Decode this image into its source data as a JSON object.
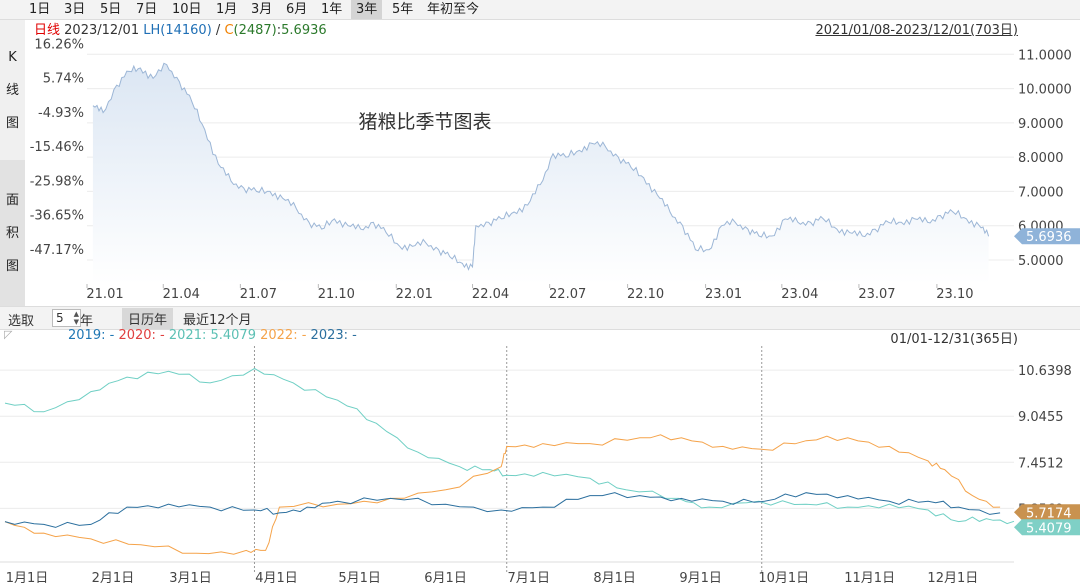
{
  "period_tabs": [
    {
      "label": "1日",
      "active": false
    },
    {
      "label": "3日",
      "active": false
    },
    {
      "label": "5日",
      "active": false
    },
    {
      "label": "7日",
      "active": false
    },
    {
      "label": "10日",
      "active": false
    },
    {
      "label": "1月",
      "active": false
    },
    {
      "label": "3月",
      "active": false
    },
    {
      "label": "6月",
      "active": false
    },
    {
      "label": "1年",
      "active": false
    },
    {
      "label": "3年",
      "active": true
    },
    {
      "label": "5年",
      "active": false
    },
    {
      "label": "年初至今",
      "active": false
    }
  ],
  "side_tabs": {
    "kline": [
      "K",
      "线",
      "图"
    ],
    "area": [
      "面",
      "积",
      "图"
    ]
  },
  "top_info": {
    "kind": "日线",
    "date": "2023/12/01",
    "lh_label": "LH",
    "lh_value": "(14160)",
    "slash": "/",
    "c_label": "C",
    "c_value": "(2487)",
    "colon": ":",
    "value": "5.6936",
    "range": "2021/01/08-2023/12/01(703日)"
  },
  "colors": {
    "kind": "#e00000",
    "lh": "#1f6fb5",
    "c": "#f08000",
    "value": "#2c7a2c",
    "line": "#9cb6d6",
    "badge": "#8fb3d9",
    "s2019": "#1f77b4",
    "s2020": "#e04040",
    "s2021": "#6fcfc4",
    "s2022": "#f5a34a",
    "s2023": "#2b6f9e"
  },
  "controls": {
    "select_label": "选取",
    "years": "5",
    "year_unit": "年",
    "calendar_button": "日历年",
    "recent_button": "最近12个月"
  },
  "legend": [
    {
      "label": "2019: -",
      "key": "s2019"
    },
    {
      "label": "2020: -",
      "key": "s2020"
    },
    {
      "label": "2021: 5.4079",
      "key": "s2021"
    },
    {
      "label": "2022: -",
      "key": "s2022"
    },
    {
      "label": "2023: -",
      "key": "s2023"
    }
  ],
  "bottom_range": "01/01-12/31(365日)",
  "chart_data": [
    {
      "type": "area",
      "title": "猪粮比季节图表",
      "x_ticks": [
        "21.01",
        "21.04",
        "21.07",
        "21.10",
        "22.01",
        "22.04",
        "22.07",
        "22.10",
        "23.01",
        "23.04",
        "23.07",
        "23.10"
      ],
      "y_right_ticks": [
        "11.0000",
        "10.0000",
        "9.0000",
        "8.0000",
        "7.0000",
        "6.0000",
        "5.0000"
      ],
      "y_left_ticks": [
        "16.26%",
        "5.74%",
        "-4.93%",
        "-15.46%",
        "-25.98%",
        "-36.65%",
        "-47.17%"
      ],
      "ylim": [
        4.3,
        11.3
      ],
      "last_value": "5.6936",
      "series": [
        {
          "x": [
            "2021-01-08",
            "2021-01-20",
            "2021-02-05",
            "2021-02-20",
            "2021-03-05",
            "2021-03-20",
            "2021-04-05",
            "2021-04-20",
            "2021-05-05",
            "2021-05-20",
            "2021-06-05",
            "2021-06-20",
            "2021-07-05",
            "2021-07-20",
            "2021-08-05",
            "2021-08-20",
            "2021-09-05",
            "2021-09-20",
            "2021-10-05",
            "2021-10-20",
            "2021-11-05",
            "2021-11-20",
            "2021-12-05",
            "2021-12-20",
            "2022-01-05",
            "2022-01-20",
            "2022-02-05",
            "2022-02-20",
            "2022-03-05",
            "2022-03-20",
            "2022-04-01",
            "2022-04-05",
            "2022-04-20",
            "2022-05-05",
            "2022-05-20",
            "2022-06-05",
            "2022-06-20",
            "2022-07-05",
            "2022-07-20",
            "2022-08-05",
            "2022-08-20",
            "2022-09-05",
            "2022-09-20",
            "2022-10-05",
            "2022-10-20",
            "2022-11-05",
            "2022-11-20",
            "2022-12-05",
            "2022-12-20",
            "2023-01-05",
            "2023-01-20",
            "2023-02-05",
            "2023-02-20",
            "2023-03-05",
            "2023-03-20",
            "2023-04-05",
            "2023-04-20",
            "2023-05-05",
            "2023-05-20",
            "2023-06-05",
            "2023-06-20",
            "2023-07-05",
            "2023-07-20",
            "2023-08-05",
            "2023-08-20",
            "2023-09-05",
            "2023-09-20",
            "2023-10-05",
            "2023-10-20",
            "2023-11-05",
            "2023-11-20",
            "2023-12-01"
          ],
          "y": [
            9.5,
            9.3,
            10.1,
            10.5,
            10.6,
            10.3,
            10.7,
            10.2,
            9.6,
            8.8,
            7.8,
            7.3,
            7.1,
            7.0,
            7.0,
            6.8,
            6.5,
            6.1,
            5.9,
            6.2,
            6.0,
            5.9,
            6.1,
            5.8,
            5.4,
            5.4,
            5.5,
            5.3,
            5.1,
            4.9,
            4.8,
            6.0,
            6.1,
            6.2,
            6.4,
            6.6,
            7.2,
            8.1,
            8.0,
            8.2,
            8.4,
            8.3,
            8.0,
            7.7,
            7.4,
            6.9,
            6.4,
            6.0,
            5.3,
            5.3,
            6.0,
            6.1,
            5.9,
            5.7,
            5.7,
            6.2,
            6.1,
            6.1,
            6.2,
            5.9,
            5.8,
            5.7,
            5.9,
            6.1,
            6.1,
            6.2,
            6.1,
            6.3,
            6.4,
            6.2,
            6.0,
            5.69
          ]
        }
      ]
    },
    {
      "type": "line",
      "title": "",
      "x_ticks": [
        "1月1日",
        "2月1日",
        "3月1日",
        "4月1日",
        "5月1日",
        "6月1日",
        "7月1日",
        "8月1日",
        "9月1日",
        "10月1日",
        "11月1日",
        "12月1日"
      ],
      "y_ticks": [
        "10.6398",
        "9.0455",
        "7.4512",
        "5.8569"
      ],
      "ylim": [
        4.0,
        11.2
      ],
      "end_badges": [
        "5.7174",
        "5.4079"
      ],
      "series": [
        {
          "name": "2021",
          "key": "s2021",
          "x": [
            1,
            15,
            32,
            45,
            60,
            75,
            91,
            105,
            121,
            135,
            150,
            165,
            176,
            182,
            195,
            212,
            225,
            244,
            255,
            273,
            290,
            305,
            320,
            334,
            345,
            355,
            365
          ],
          "y": [
            9.5,
            9.2,
            9.9,
            10.4,
            10.6,
            10.2,
            10.7,
            10.2,
            9.6,
            8.8,
            7.8,
            7.3,
            7.2,
            7.0,
            7.1,
            6.9,
            6.5,
            6.2,
            5.9,
            6.1,
            6.0,
            5.9,
            6.0,
            5.8,
            5.4,
            5.5,
            5.41
          ]
        },
        {
          "name": "2022",
          "key": "s2022",
          "x": [
            1,
            15,
            32,
            50,
            70,
            88,
            95,
            100,
            121,
            140,
            160,
            180,
            182,
            195,
            212,
            230,
            245,
            260,
            274,
            290,
            305,
            320,
            334,
            340,
            350,
            360
          ],
          "y": [
            5.4,
            5.0,
            4.8,
            4.6,
            4.3,
            4.4,
            4.4,
            5.9,
            6.0,
            6.2,
            6.5,
            7.3,
            8.0,
            8.1,
            8.1,
            8.3,
            8.3,
            8.0,
            7.9,
            8.2,
            8.3,
            8.0,
            7.5,
            7.2,
            6.3,
            5.9
          ]
        },
        {
          "name": "2023",
          "key": "s2023",
          "x": [
            1,
            15,
            32,
            45,
            60,
            75,
            91,
            100,
            110,
            121,
            140,
            160,
            180,
            195,
            212,
            230,
            245,
            260,
            275,
            290,
            305,
            320,
            334,
            345,
            360
          ],
          "y": [
            5.4,
            5.3,
            5.3,
            5.9,
            6.0,
            5.9,
            5.8,
            5.7,
            5.9,
            6.1,
            6.2,
            6.0,
            5.8,
            5.9,
            6.3,
            6.3,
            6.2,
            6.1,
            6.1,
            6.4,
            6.3,
            6.1,
            6.1,
            5.9,
            5.7
          ]
        }
      ]
    }
  ]
}
